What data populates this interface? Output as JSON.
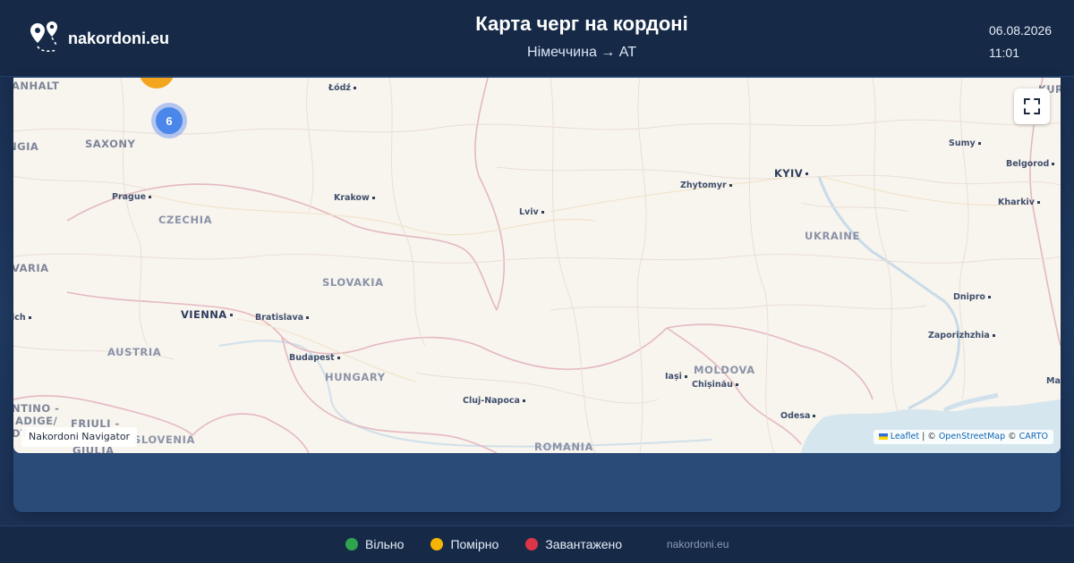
{
  "header": {
    "brand": "nakordoni.eu",
    "title": "Карта черг на кордоні",
    "subtitle": "Німеччина → AT",
    "date": "06.08.2026",
    "time": "11:01"
  },
  "map": {
    "cluster_count": "6",
    "navigator_label": "Nakordoni Navigator",
    "attribution": {
      "leaflet": "Leaflet",
      "sep1": " | © ",
      "osm": "OpenStreetMap",
      "sep2": " © ",
      "carto": "CARTO"
    },
    "labels": {
      "anhalt": "ANHALT",
      "ngia": "NGIA",
      "saxony": "SAXONY",
      "prague": "Prague",
      "czechia": "CZECHIA",
      "varia": "VARIA",
      "ich": "ich",
      "vienna": "VIENNA",
      "bratislava": "Bratislava",
      "austria": "AUSTRIA",
      "slovakia": "SLOVAKIA",
      "budapest": "Budapest",
      "hungary": "HUNGARY",
      "ntino": "NTINO -",
      "adige": "ADIGE/",
      "dt": "DT",
      "friuli": "FRIULI -",
      "giulia": "GIULIA",
      "slovenia": "SLOVENIA",
      "lodz": "Łódź",
      "krakow": "Krakow",
      "lviv": "Lviv",
      "cluj": "Cluj-Napoca",
      "romania": "ROMANIA",
      "zhytomyr": "Zhytomyr",
      "kyiv": "KYIV",
      "ukraine": "UKRAINE",
      "sumy": "Sumy",
      "belgorod": "Belgorod",
      "kharkiv": "Kharkiv",
      "dnipro": "Dnipro",
      "zaporizhzhia": "Zaporizhzhia",
      "iasi": "Iași",
      "moldova": "MOLDOVA",
      "chisinau": "Chișinău",
      "odesa": "Odesa",
      "kursk": "KURSK",
      "ma": "Ma"
    }
  },
  "legend": [
    {
      "label": "Вільно",
      "color": "#2ea44f"
    },
    {
      "label": "Помірно",
      "color": "#f4b400"
    },
    {
      "label": "Завантажено",
      "color": "#dc3545"
    }
  ],
  "footer": {
    "site": "nakordoni.eu"
  }
}
